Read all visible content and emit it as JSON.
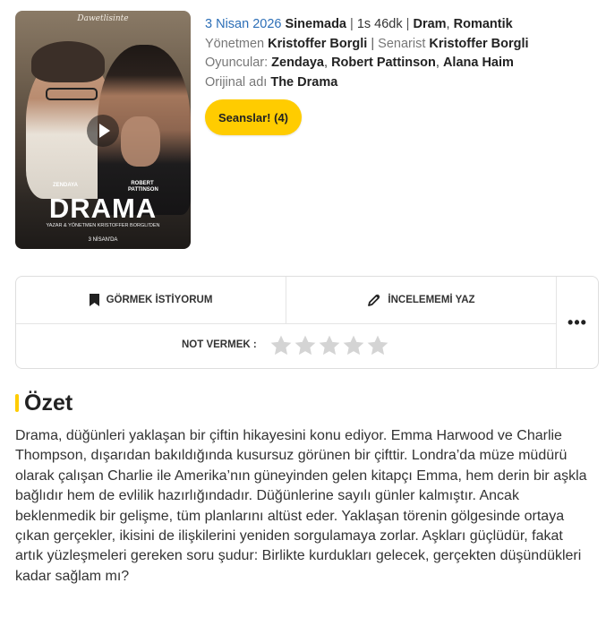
{
  "poster": {
    "brand": "Dawetlisinte",
    "credit_left": "ZENDAYA",
    "credit_right": "ROBERT PATTINSON",
    "title": "DRAMA",
    "tagline": "YAZAR & YÖNETMEN KRISTOFFER BORGLI'DEN",
    "release": "3 NİSAN'DA"
  },
  "info": {
    "date": "3 Nisan 2026",
    "status": "Sinemada",
    "duration": "1s 46dk",
    "genre1": "Dram",
    "genre2": "Romantik",
    "director_label": "Yönetmen",
    "director": "Kristoffer Borgli",
    "writer_label": "Senarist",
    "writer": "Kristoffer Borgli",
    "cast_label": "Oyuncular:",
    "cast1": "Zendaya",
    "cast2": "Robert Pattinson",
    "cast3": "Alana Haim",
    "original_label": "Orijinal adı",
    "original": "The Drama"
  },
  "seans_button": "Seanslar! (4)",
  "actions": {
    "watchlist": "GÖRMEK İSTİYORUM",
    "review": "İNCELEMEMİ YAZ",
    "more": "•••",
    "rate_label": "NOT VERMEK :",
    "stars_total": 5,
    "star_color": "#d4d4d4"
  },
  "summary": {
    "heading": "Özet",
    "accent": "#ffcc00",
    "text": "Drama, düğünleri yaklaşan bir çiftin hikayesini konu ediyor. Emma Harwood ve Charlie Thompson, dışarıdan bakıldığında kusursuz görünen bir çifttir. Londra’da müze müdürü olarak çalışan Charlie ile Amerika’nın güneyinden gelen kitapçı Emma, hem derin bir aşkla bağlıdır hem de evlilik hazırlığındadır. Düğünlerine sayılı günler kalmıştır. Ancak beklenmedik bir gelişme, tüm planlarını altüst eder. Yaklaşan törenin gölgesinde ortaya çıkan gerçekler, ikisini de ilişkilerini yeniden sorgulamaya zorlar. Aşkları güçlüdür, fakat artık yüzleşmeleri gereken soru şudur: Birlikte kurdukları gelecek, gerçekten düşündükleri kadar sağlam mı?"
  }
}
